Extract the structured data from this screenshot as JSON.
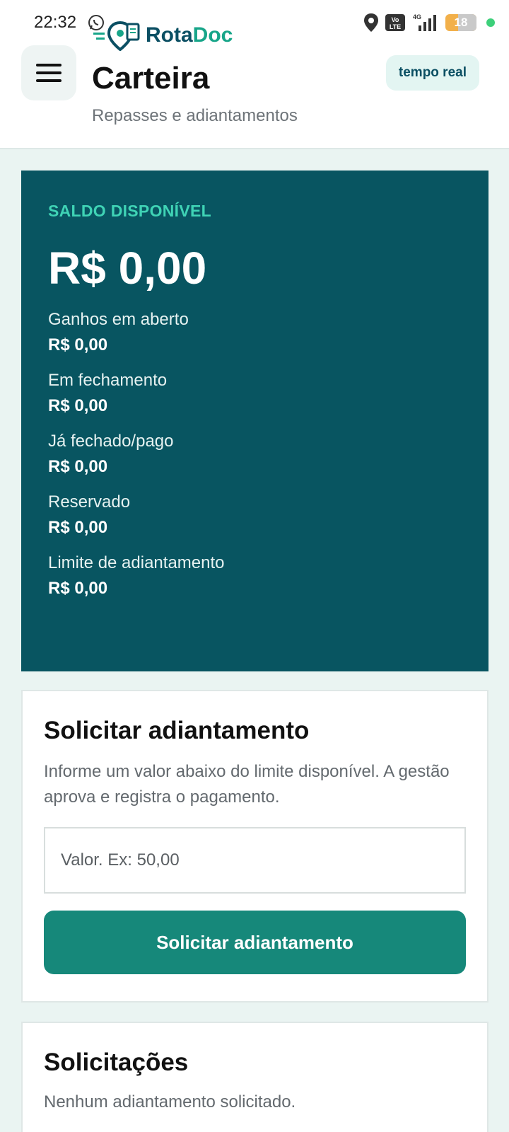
{
  "status_bar": {
    "time": "22:32",
    "network": "4G",
    "volte": "Vo LTE",
    "battery": "18"
  },
  "header": {
    "logo_part1": "Rota",
    "logo_part2": "Doc",
    "title": "Carteira",
    "subtitle": "Repasses e adiantamentos",
    "badge": "tempo real"
  },
  "balance": {
    "label": "SALDO DISPONÍVEL",
    "amount": "R$ 0,00",
    "items": [
      {
        "label": "Ganhos em aberto",
        "value": "R$ 0,00"
      },
      {
        "label": "Em fechamento",
        "value": "R$ 0,00"
      },
      {
        "label": "Já fechado/pago",
        "value": "R$ 0,00"
      },
      {
        "label": "Reservado",
        "value": "R$ 0,00"
      },
      {
        "label": "Limite de adiantamento",
        "value": "R$ 0,00"
      }
    ]
  },
  "request": {
    "title": "Solicitar adiantamento",
    "description": "Informe um valor abaixo do limite disponível. A gestão aprova e registra o pagamento.",
    "input_placeholder": "Valor. Ex: 50,00",
    "input_value": "",
    "button_label": "Solicitar adiantamento"
  },
  "requests_list": {
    "title": "Solicitações",
    "empty_text": "Nenhum adiantamento solicitado."
  },
  "colors": {
    "card_bg": "#085561",
    "accent": "#3fd3b5",
    "button": "#16887a",
    "page_bg": "#eaf4f2"
  }
}
